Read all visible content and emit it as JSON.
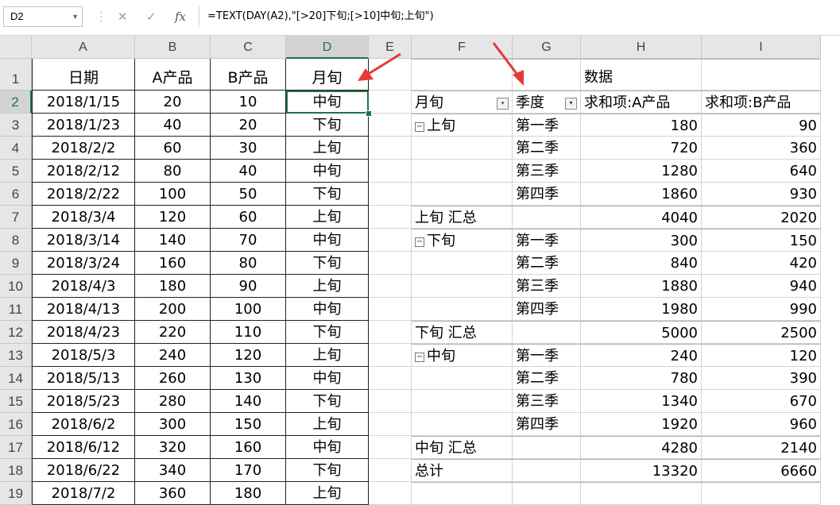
{
  "formula_bar": {
    "name_box": "D2",
    "cancel_icon": "✕",
    "enter_icon": "✓",
    "fx_icon": "fx",
    "formula": "=TEXT(DAY(A2),\"[>20]下旬;[>10]中旬;上旬\")"
  },
  "columns": [
    "A",
    "B",
    "C",
    "D",
    "E",
    "F",
    "G",
    "H",
    "I"
  ],
  "rows": [
    "1",
    "2",
    "3",
    "4",
    "5",
    "6",
    "7",
    "8",
    "9",
    "10",
    "11",
    "12",
    "13",
    "14",
    "15",
    "16",
    "17",
    "18",
    "19"
  ],
  "table": {
    "headers": [
      "日期",
      "A产品",
      "B产品",
      "月旬"
    ],
    "data": [
      [
        "2018/1/15",
        "20",
        "10",
        "中旬"
      ],
      [
        "2018/1/23",
        "40",
        "20",
        "下旬"
      ],
      [
        "2018/2/2",
        "60",
        "30",
        "上旬"
      ],
      [
        "2018/2/12",
        "80",
        "40",
        "中旬"
      ],
      [
        "2018/2/22",
        "100",
        "50",
        "下旬"
      ],
      [
        "2018/3/4",
        "120",
        "60",
        "上旬"
      ],
      [
        "2018/3/14",
        "140",
        "70",
        "中旬"
      ],
      [
        "2018/3/24",
        "160",
        "80",
        "下旬"
      ],
      [
        "2018/4/3",
        "180",
        "90",
        "上旬"
      ],
      [
        "2018/4/13",
        "200",
        "100",
        "中旬"
      ],
      [
        "2018/4/23",
        "220",
        "110",
        "下旬"
      ],
      [
        "2018/5/3",
        "240",
        "120",
        "上旬"
      ],
      [
        "2018/5/13",
        "260",
        "130",
        "中旬"
      ],
      [
        "2018/5/23",
        "280",
        "140",
        "下旬"
      ],
      [
        "2018/6/2",
        "300",
        "150",
        "上旬"
      ],
      [
        "2018/6/12",
        "320",
        "160",
        "中旬"
      ],
      [
        "2018/6/22",
        "340",
        "170",
        "下旬"
      ],
      [
        "2018/7/2",
        "360",
        "180",
        "上旬"
      ]
    ]
  },
  "pivot": {
    "data_label": "数据",
    "row_field_1": "月旬",
    "row_field_2": "季度",
    "value_header_1": "求和项:A产品",
    "value_header_2": "求和项:B产品",
    "collapse_icon": "−",
    "dropdown_icon": "▾",
    "groups": [
      {
        "name": "上旬",
        "rows": [
          [
            "第一季",
            "180",
            "90"
          ],
          [
            "第二季",
            "720",
            "360"
          ],
          [
            "第三季",
            "1280",
            "640"
          ],
          [
            "第四季",
            "1860",
            "930"
          ]
        ],
        "subtotal_label": "上旬 汇总",
        "subtotal": [
          "4040",
          "2020"
        ]
      },
      {
        "name": "下旬",
        "rows": [
          [
            "第一季",
            "300",
            "150"
          ],
          [
            "第二季",
            "840",
            "420"
          ],
          [
            "第三季",
            "1880",
            "940"
          ],
          [
            "第四季",
            "1980",
            "990"
          ]
        ],
        "subtotal_label": "下旬 汇总",
        "subtotal": [
          "5000",
          "2500"
        ]
      },
      {
        "name": "中旬",
        "rows": [
          [
            "第一季",
            "240",
            "120"
          ],
          [
            "第二季",
            "780",
            "390"
          ],
          [
            "第三季",
            "1340",
            "670"
          ],
          [
            "第四季",
            "1920",
            "960"
          ]
        ],
        "subtotal_label": "中旬 汇总",
        "subtotal": [
          "4280",
          "2140"
        ]
      }
    ],
    "grand_total_label": "总计",
    "grand_total": [
      "13320",
      "6660"
    ]
  },
  "annotation_color": "#e53935"
}
